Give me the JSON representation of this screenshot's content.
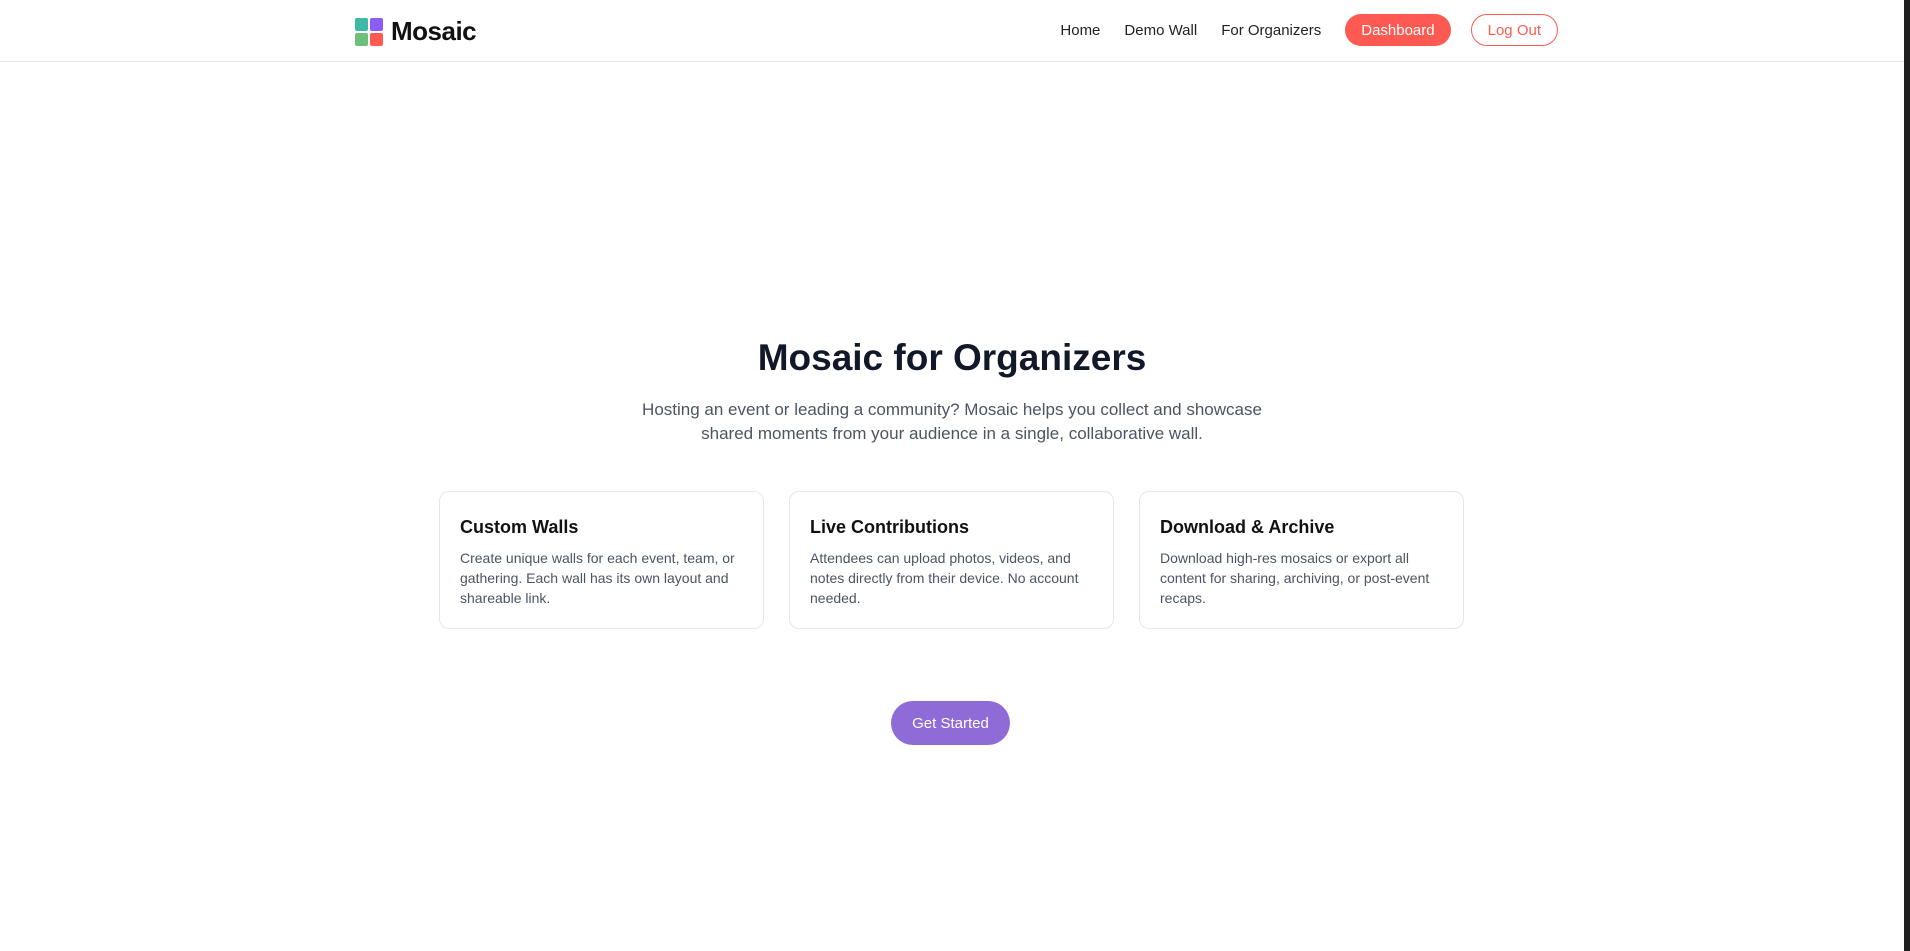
{
  "colors": {
    "brand_red": "#ff5a52",
    "brand_purple": "#8e6bd6",
    "logo_teal": "#3fb8a8",
    "logo_violet": "#8b5cf6",
    "logo_green": "#6cc07a",
    "logo_red": "#ff5a52"
  },
  "header": {
    "brand_name": "Mosaic",
    "logo_icon": "mosaic-grid-icon",
    "nav": {
      "home": "Home",
      "demo_wall": "Demo Wall",
      "for_organizers": "For Organizers"
    },
    "dashboard_label": "Dashboard",
    "logout_label": "Log Out"
  },
  "hero": {
    "title": "Mosaic for Organizers",
    "subtitle": "Hosting an event or leading a community? Mosaic helps you collect and showcase shared moments from your audience in a single, collaborative wall."
  },
  "features": [
    {
      "title": "Custom Walls",
      "text": "Create unique walls for each event, team, or gathering. Each wall has its own layout and shareable link."
    },
    {
      "title": "Live Contributions",
      "text": "Attendees can upload photos, videos, and notes directly from their device. No account needed."
    },
    {
      "title": "Download & Archive",
      "text": "Download high-res mosaics or export all content for sharing, archiving, or post-event recaps."
    }
  ],
  "cta": {
    "label": "Get Started"
  }
}
